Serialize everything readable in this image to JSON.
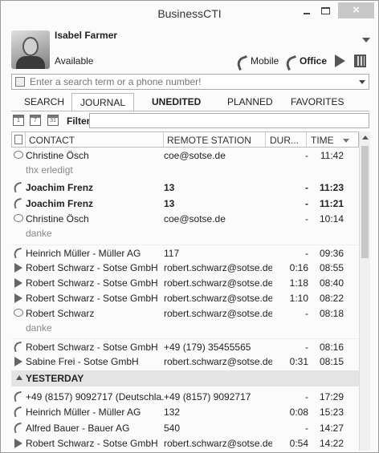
{
  "window": {
    "title": "BusinessCTI",
    "close_label": "×"
  },
  "user": {
    "name": "Isabel Farmer",
    "status": "Available"
  },
  "devices": {
    "mobile_label": "Mobile",
    "office_label": "Office"
  },
  "search": {
    "placeholder": "Enter a search term or a phone number!"
  },
  "tabs": [
    {
      "label": "SEARCH"
    },
    {
      "label": "JOURNAL"
    },
    {
      "label": "UNEDITED"
    },
    {
      "label": "PLANNED"
    },
    {
      "label": "FAVORITES"
    }
  ],
  "filter": {
    "label": "Filter",
    "value": ""
  },
  "columns": {
    "contact": "CONTACT",
    "station": "REMOTE STATION",
    "duration": "DUR...",
    "time": "TIME"
  },
  "today_rows": [
    {
      "icon": "chat-icon",
      "contact": "Christine Ösch",
      "station": "coe@sotse.de",
      "duration": "-",
      "time": "11:42",
      "note": "thx erledigt",
      "bold": false
    },
    {
      "icon": "missed-call-icon",
      "contact": "Joachim Frenz",
      "station": "13",
      "duration": "-",
      "time": "11:23",
      "note": "",
      "bold": true
    },
    {
      "icon": "missed-call-icon",
      "contact": "Joachim Frenz",
      "station": "13",
      "duration": "-",
      "time": "11:21",
      "note": "",
      "bold": true
    },
    {
      "icon": "chat-icon",
      "contact": "Christine Ösch",
      "station": "coe@sotse.de",
      "duration": "-",
      "time": "10:14",
      "note": "danke",
      "bold": false
    },
    {
      "icon": "missed-call-icon",
      "contact": "Heinrich Müller - Müller AG",
      "station": "117",
      "duration": "-",
      "time": "09:36",
      "note": "",
      "bold": false
    },
    {
      "icon": "video-icon",
      "contact": "Robert Schwarz - Sotse GmbH",
      "station": "robert.schwarz@sotse.de",
      "duration": "0:16",
      "time": "08:55",
      "note": "",
      "bold": false
    },
    {
      "icon": "video-icon",
      "contact": "Robert Schwarz - Sotse GmbH",
      "station": "robert.schwarz@sotse.de",
      "duration": "1:18",
      "time": "08:40",
      "note": "",
      "bold": false
    },
    {
      "icon": "video-icon",
      "contact": "Robert Schwarz - Sotse GmbH",
      "station": "robert.schwarz@sotse.de",
      "duration": "1:10",
      "time": "08:22",
      "note": "",
      "bold": false
    },
    {
      "icon": "chat-icon",
      "contact": "Robert Schwarz",
      "station": "robert.schwarz@sotse.de",
      "duration": "-",
      "time": "08:18",
      "note": "danke",
      "bold": false
    },
    {
      "icon": "missed-call-icon",
      "contact": "Robert Schwarz - Sotse GmbH",
      "station": "+49 (179) 35455565",
      "duration": "-",
      "time": "08:16",
      "note": "",
      "bold": false
    },
    {
      "icon": "video-icon",
      "contact": "Sabine Frei - Sotse GmbH",
      "station": "robert.schwarz@sotse.de",
      "duration": "0:31",
      "time": "08:15",
      "note": "",
      "bold": false
    }
  ],
  "group_label": "YESTERDAY",
  "yesterday_rows": [
    {
      "icon": "missed-call-icon",
      "contact": "+49 (8157) 9092717   (Deutschla...",
      "station": "+49 (8157) 9092717",
      "duration": "-",
      "time": "17:29"
    },
    {
      "icon": "phone-icon",
      "contact": "Heinrich Müller - Müller AG",
      "station": "132",
      "duration": "0:08",
      "time": "15:23"
    },
    {
      "icon": "missed-call-icon",
      "contact": "Alfred Bauer - Bauer AG",
      "station": "540",
      "duration": "-",
      "time": "14:27"
    },
    {
      "icon": "video-icon",
      "contact": "Robert Schwarz - Sotse GmbH",
      "station": "robert.schwarz@sotse.de",
      "duration": "0:54",
      "time": "14:22"
    }
  ]
}
